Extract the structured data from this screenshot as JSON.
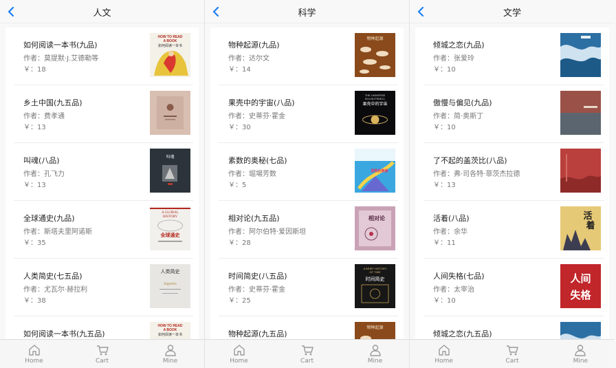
{
  "panels": [
    {
      "title": "人文",
      "books": [
        {
          "title": "如何阅读一本书(九品)",
          "author": "作者：莫提默·J.艾德勒等",
          "price": "￥：18",
          "cover": "reading-book"
        },
        {
          "title": "乡土中国(九五品)",
          "author": "作者：费孝通",
          "price": "￥：13",
          "cover": "rural-china"
        },
        {
          "title": "叫魂(八品)",
          "author": "作者：孔飞力",
          "price": "￥：13",
          "cover": "soulstealers"
        },
        {
          "title": "全球通史(九品)",
          "author": "作者：斯塔夫里阿诺斯",
          "price": "￥：35",
          "cover": "global-history"
        },
        {
          "title": "人类简史(七五品)",
          "author": "作者：尤瓦尔·赫拉利",
          "price": "￥：38",
          "cover": "sapiens"
        },
        {
          "title": "如何阅读一本书(九五品)",
          "author": "",
          "price": "",
          "cover": "reading-book"
        }
      ],
      "cover_text": {
        "reading-book": [
          "HOW TO READ",
          "A BOOK",
          "如何阅读一本书"
        ],
        "global-history": [
          "A GLOBAL",
          "HISTORY",
          "全球通史"
        ],
        "sapiens": [
          "人类简史",
          "Sapiens"
        ],
        "soulstealers": [
          "叫魂"
        ]
      }
    },
    {
      "title": "科学",
      "books": [
        {
          "title": "物种起源(九品)",
          "author": "作者：达尔文",
          "price": "￥：14",
          "cover": "origin-species"
        },
        {
          "title": "果壳中的宇宙(八品)",
          "author": "作者：史蒂芬·霍金",
          "price": "￥：30",
          "cover": "universe-nutshell"
        },
        {
          "title": "素数的奥秘(七品)",
          "author": "作者：堀場芳数",
          "price": "￥：5",
          "cover": "prime-numbers"
        },
        {
          "title": "相对论(九五品)",
          "author": "作者：阿尔伯特·爱因斯坦",
          "price": "￥：28",
          "cover": "relativity"
        },
        {
          "title": "时间简史(八五品)",
          "author": "作者：史蒂芬·霍金",
          "price": "￥：25",
          "cover": "brief-history-time"
        },
        {
          "title": "物种起源(九五品)",
          "author": "",
          "price": "",
          "cover": "origin-species"
        }
      ],
      "cover_text": {
        "origin-species": [
          "物种起源"
        ],
        "universe-nutshell": [
          "THE UNIVERSE",
          "IN A NUTSHELL",
          "果壳中的宇宙"
        ],
        "relativity": [
          "相对论"
        ],
        "brief-history-time": [
          "A BRIEF HISTORY",
          "OF TIME",
          "时间简史"
        ],
        "prime-numbers": [
          "素数的奥秘"
        ]
      }
    },
    {
      "title": "文学",
      "books": [
        {
          "title": "倾城之恋(九品)",
          "author": "作者：张爱玲",
          "price": "￥：10",
          "cover": "love-fallen-city"
        },
        {
          "title": "傲慢与偏见(九品)",
          "author": "作者：简·奥斯丁",
          "price": "￥：10",
          "cover": "pride-prejudice"
        },
        {
          "title": "了不起的盖茨比(八品)",
          "author": "作者：弗·司各特·菲茨杰拉德",
          "price": "￥：13",
          "cover": "great-gatsby"
        },
        {
          "title": "活着(八品)",
          "author": "作者：余华",
          "price": "￥：11",
          "cover": "to-live"
        },
        {
          "title": "人间失格(七品)",
          "author": "作者：太宰治",
          "price": "￥：10",
          "cover": "no-longer-human"
        },
        {
          "title": "倾城之恋(九五品)",
          "author": "",
          "price": "",
          "cover": "love-fallen-city"
        }
      ],
      "cover_text": {
        "to-live": [
          "活",
          "着"
        ],
        "no-longer-human": [
          "人间",
          "失格"
        ]
      }
    }
  ],
  "tabbar": [
    {
      "label": "Home",
      "icon": "home-icon"
    },
    {
      "label": "Cart",
      "icon": "cart-icon"
    },
    {
      "label": "Mine",
      "icon": "user-icon"
    }
  ],
  "colors": {
    "accent": "#1a7ef5",
    "tab_label": "#8a8a8a"
  }
}
